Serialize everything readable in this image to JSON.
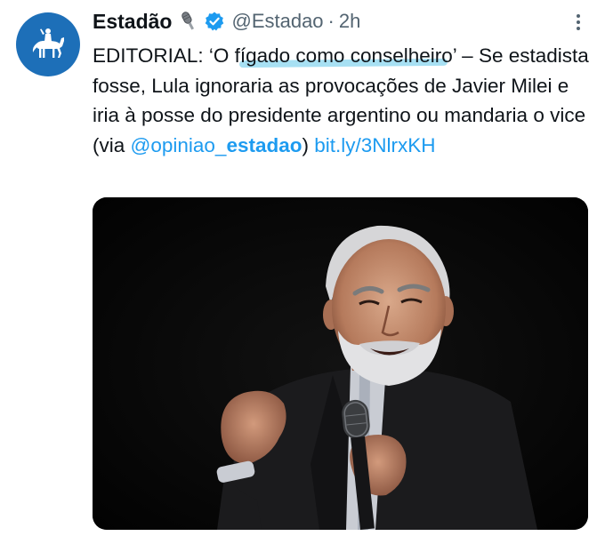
{
  "tweet": {
    "author_name": "Estadão",
    "handle": "@Estadao",
    "separator": "·",
    "time": "2h",
    "text_prefix": "EDITORIAL: ‘O fígado como conselheiro’ – Se estadista fosse, Lula ignoraria as provocações de Javier Milei e iria à posse do presidente argentino ou mandaria o vice (via ",
    "mention_at": "@opiniao_",
    "mention_bold": "estadao",
    "text_close": ")",
    "link": "bit.ly/3NlrxKH"
  },
  "icons": {
    "avatar": "estadao-horse-rider-logo",
    "affiliation": "microphone-badge-icon",
    "verified": "verified-badge-icon",
    "more": "more-options-icon"
  },
  "colors": {
    "avatar_bg": "#1d6fb8",
    "link": "#1d9bf0",
    "secondary_text": "#536471",
    "highlight": "#5ec6ea"
  }
}
